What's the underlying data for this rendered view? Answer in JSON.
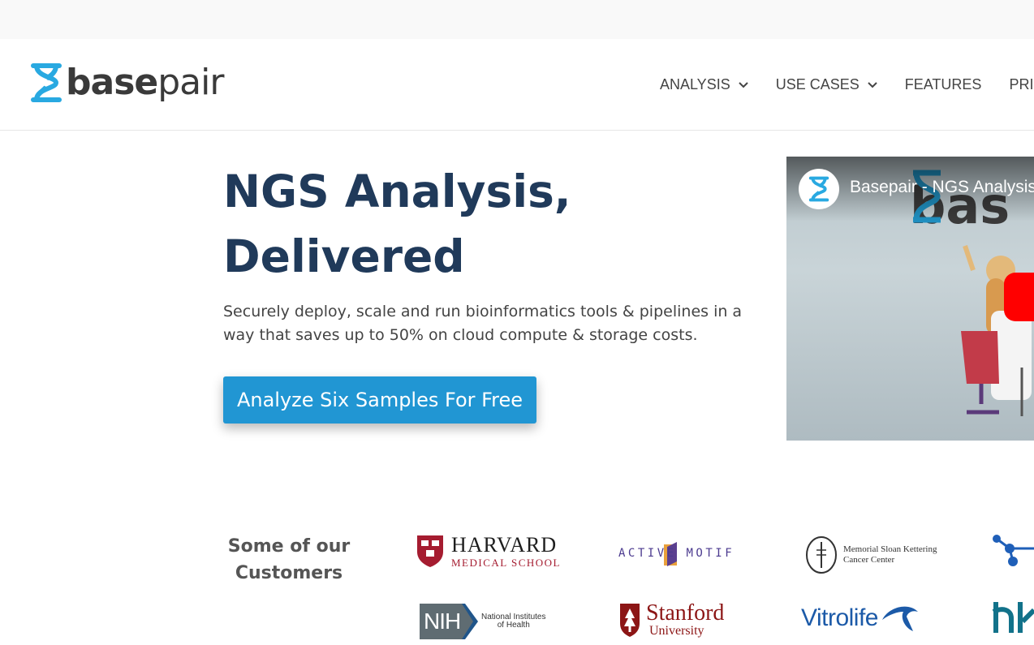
{
  "header": {
    "logo": {
      "base": "base",
      "pair": "pair"
    },
    "nav": [
      {
        "label": "ANALYSIS",
        "has_dropdown": true
      },
      {
        "label": "USE CASES",
        "has_dropdown": true
      },
      {
        "label": "FEATURES",
        "has_dropdown": false
      },
      {
        "label": "PRICING",
        "has_dropdown": false
      }
    ]
  },
  "hero": {
    "title_line1": "NGS Analysis,",
    "title_line2": "Delivered",
    "subtitle": "Securely deploy, scale and run bioinformatics tools & pipelines in a way that saves up to 50% on cloud compute & storage costs.",
    "cta_label": "Analyze Six Samples For Free"
  },
  "video": {
    "title": "Basepair - NGS Analysis"
  },
  "customers": {
    "label": "Some of our Customers",
    "logos": {
      "harvard": {
        "line1": "HARVARD",
        "line2": "MEDICAL SCHOOL"
      },
      "active_motif": {
        "text": "ACTIVE MOTIF"
      },
      "mskcc": {
        "line1": "Memorial Sloan Kettering",
        "line2": "Cancer Center"
      },
      "nih": {
        "mark": "NIH",
        "line1": "National Institutes",
        "line2": "of Health"
      },
      "stanford": {
        "line1": "Stanford",
        "line2": "University"
      },
      "vitrolife": {
        "text": "Vitrolife"
      }
    }
  },
  "colors": {
    "brand_blue": "#2196d3",
    "title_navy": "#203a5a",
    "logo_cyan": "#29a9e1"
  }
}
